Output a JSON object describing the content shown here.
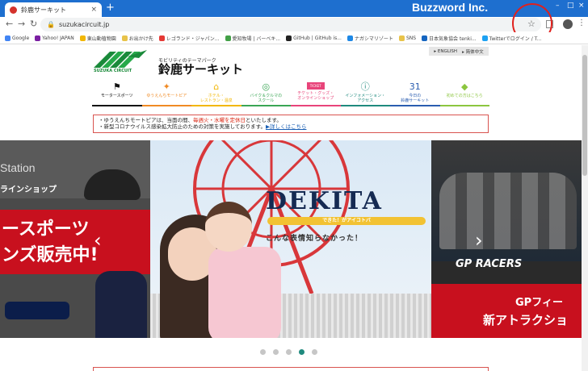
{
  "browser": {
    "tab_title": "鈴鹿サーキット",
    "tab_close": "×",
    "new_tab": "+",
    "brand": "Buzzword Inc.",
    "window_controls": [
      "–",
      "□",
      "×"
    ],
    "url": "suzukacircuit.jp",
    "nav": {
      "back": "←",
      "forward": "→",
      "reload": "↻"
    },
    "star": "☆",
    "kebab": "⋮",
    "bookmarks": [
      {
        "label": "Google",
        "color": "#4285f4"
      },
      {
        "label": "Yahoo! JAPAN",
        "color": "#7b1fa2"
      },
      {
        "label": "東山動植物園",
        "color": "#f2b705"
      },
      {
        "label": "お出かけ先",
        "color": "#e8c34a"
      },
      {
        "label": "レゴランド・ジャパン...",
        "color": "#e53935"
      },
      {
        "label": "愛知牧場 | バーベキ...",
        "color": "#43a047"
      },
      {
        "label": "GitHub | GitHub is...",
        "color": "#222222"
      },
      {
        "label": "ナガシマリゾート",
        "color": "#1e88e5"
      },
      {
        "label": "SNS",
        "color": "#e8c34a"
      },
      {
        "label": "日本気象協会 tenki...",
        "color": "#1565c0"
      },
      {
        "label": "Twitterでログイン / T...",
        "color": "#1da1f2"
      }
    ]
  },
  "site": {
    "logo_sub": "SUZUKA CIRCUIT",
    "tagline": "モビリティのテーマパーク",
    "name": "鈴鹿サーキット",
    "lang_en": "▸ ENGLISH",
    "lang_zh": "▸ 简体中文",
    "nav": [
      {
        "label": "モータースポーツ",
        "icon": "⚑",
        "icon_color": "#111111",
        "bar": "#111111"
      },
      {
        "label": "ゆうえんちモートピア",
        "icon": "✦",
        "icon_color": "#f08a24",
        "bar": "#f08a24"
      },
      {
        "label": "ホテル・\nレストラン・温泉",
        "icon": "⌂",
        "icon_color": "#f2b705",
        "bar": "#f2b705"
      },
      {
        "label": "バイク＆クルマの\nスクール",
        "icon": "◎",
        "icon_color": "#3aa655",
        "bar": "#3aa655"
      },
      {
        "label": "チケット・グッズ・\nオンラインショップ",
        "icon": "TICKET",
        "icon_color": "#e8447a",
        "bar": "#e8447a"
      },
      {
        "label": "インフォメーション・\nアクセス",
        "icon": "ⓘ",
        "icon_color": "#1f8a7e",
        "bar": "#1f8a7e"
      },
      {
        "label": "今日の\n鈴鹿サーキット",
        "icon": "31",
        "icon_color": "#2a5db0",
        "bar": "#2a5db0"
      },
      {
        "label": "初めての方はこちら",
        "icon": "◆",
        "icon_color": "#8cc63f",
        "bar": "#8cc63f"
      }
    ],
    "notice": {
      "line1_a": "・ゆうえんちモートピアは、当面の間、",
      "line1_red": "毎週火・水曜を定休日",
      "line1_b": "といたします。",
      "line2": "・新型コロナウイルス感染拡大防止のための対策を実施しております。",
      "link": "▶詳しくはこちら"
    },
    "carousel": {
      "left_station": "Station",
      "left_online": "ラインショップ",
      "left_big1": "ースポーツ",
      "left_big2": "ンズ販売中!",
      "center_title": "DEKITA",
      "center_bar": "できた！がアイコトバ",
      "center_sub": "こんな表情知らなかった！",
      "right_gp": "GP RACERS",
      "right_t1": "GPフィー",
      "right_t2": "新アトラクショ",
      "prev": "‹",
      "next": "›",
      "dots": 5,
      "active_dot": 4
    }
  }
}
